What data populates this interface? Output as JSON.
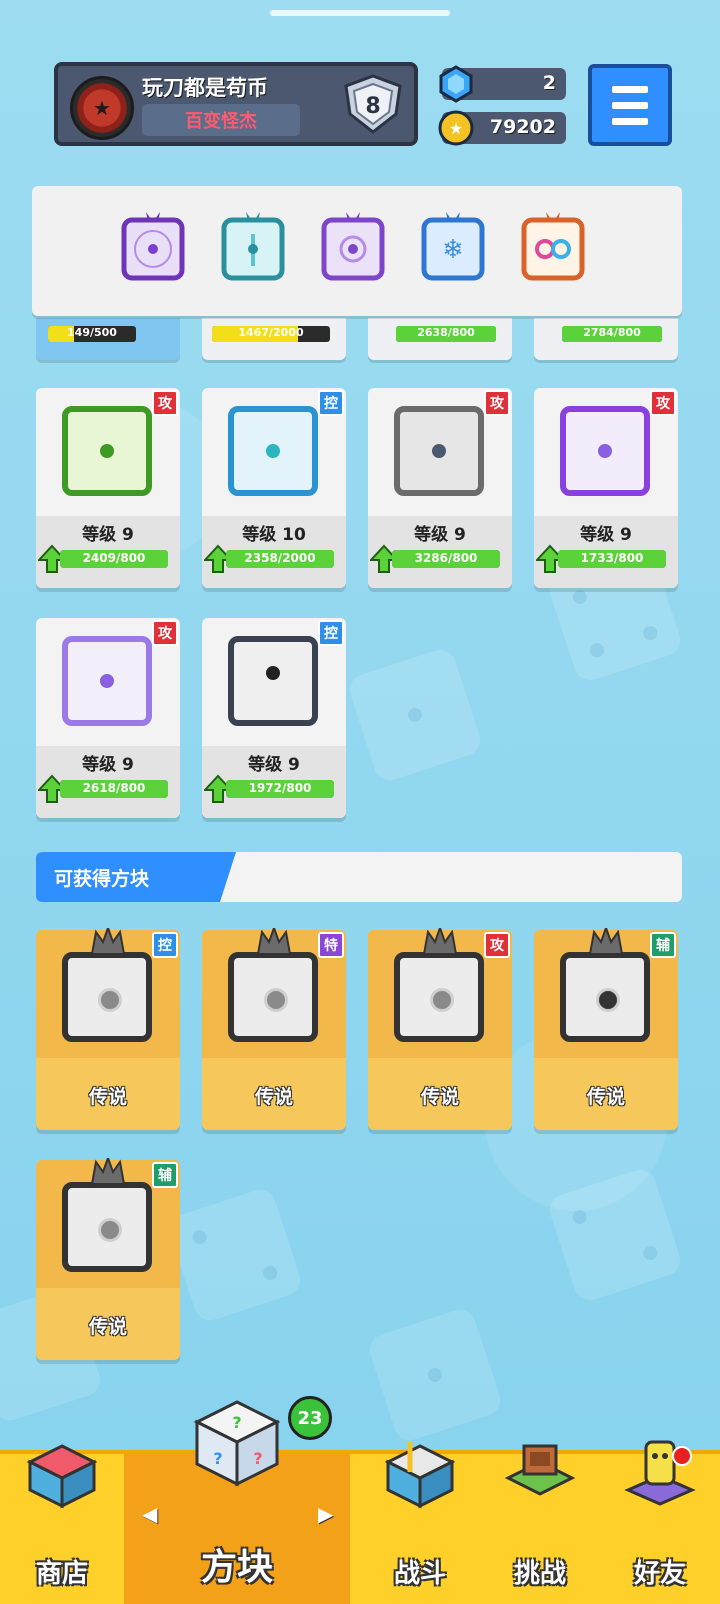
{
  "profile": {
    "name": "玩刀都是苟币",
    "title": "百变怪杰",
    "rank": "8"
  },
  "resources": {
    "gems": "2",
    "coins": "79202"
  },
  "equipped": [
    {
      "icon": "purple-magic-dice-icon",
      "color": "#9b5de5"
    },
    {
      "icon": "teal-sword-dice-icon",
      "color": "#34b9c9"
    },
    {
      "icon": "purple-mirror-dice-icon",
      "color": "#a36be0"
    },
    {
      "icon": "blue-snowflake-dice-icon",
      "color": "#3a8ee6"
    },
    {
      "icon": "rainbow-infinity-dice-icon",
      "color": "#e07a2e"
    }
  ],
  "partial_row": [
    {
      "progress": "149/500"
    },
    {
      "progress": "1467/2000"
    },
    {
      "progress": "2638/800"
    },
    {
      "progress": "2784/800"
    }
  ],
  "cards": [
    {
      "level": "等级 9",
      "progress": "2409/800",
      "tag": "攻",
      "icon": "green-acid-dice-icon",
      "fill": 1.0
    },
    {
      "level": "等级 10",
      "progress": "2358/2000",
      "tag": "控",
      "icon": "blue-ice-dice-icon",
      "fill": 1.0
    },
    {
      "level": "等级 9",
      "progress": "3286/800",
      "tag": "攻",
      "icon": "gear-dice-icon",
      "fill": 1.0
    },
    {
      "level": "等级 9",
      "progress": "1733/800",
      "tag": "攻",
      "icon": "purple-arrows-dice-icon",
      "fill": 1.0
    },
    {
      "level": "等级 9",
      "progress": "2618/800",
      "tag": "攻",
      "icon": "question-mark-dice-icon",
      "fill": 1.0
    },
    {
      "level": "等级 9",
      "progress": "1972/800",
      "tag": "控",
      "icon": "padlock-dice-icon",
      "fill": 1.0
    }
  ],
  "section": {
    "title": "可获得方块"
  },
  "legend_cards": [
    {
      "name": "传说",
      "tag": "控",
      "icon": "legend-wind-dice-icon"
    },
    {
      "name": "传说",
      "tag": "特",
      "icon": "legend-swords-dice-icon"
    },
    {
      "name": "传说",
      "tag": "攻",
      "icon": "legend-vortex-dice-icon"
    },
    {
      "name": "传说",
      "tag": "辅",
      "icon": "legend-target-dice-icon"
    },
    {
      "name": "传说",
      "tag": "辅",
      "icon": "legend-moon-dice-icon"
    }
  ],
  "nav": {
    "shop": "商店",
    "dice": "方块",
    "battle": "战斗",
    "challenge": "挑战",
    "friends": "好友",
    "dice_badge": "23"
  },
  "colors": {
    "accent": "#2f8fff",
    "nav": "#ffcf2a",
    "legend": "#f6c75a"
  }
}
